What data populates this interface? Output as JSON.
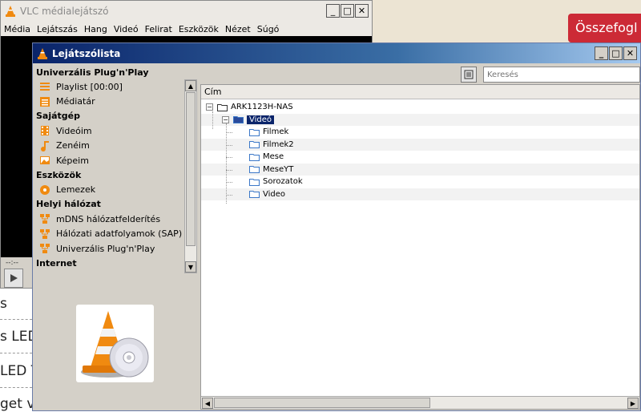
{
  "background_page": {
    "button_label": "Összefogl",
    "text_lines": [
      "s",
      "s LED",
      "LED T",
      "get v"
    ]
  },
  "vlc_main": {
    "title": "VLC médialejátszó",
    "menu": [
      "Média",
      "Lejátszás",
      "Hang",
      "Videó",
      "Felirat",
      "Eszközök",
      "Nézet",
      "Súgó"
    ],
    "time": "--:--"
  },
  "playlist": {
    "title": "Lejátszólista",
    "current_source": "Univerzális Plug'n'Play",
    "sources": [
      {
        "type": "item",
        "label": "Playlist [00:00]",
        "icon": "playlist-icon"
      },
      {
        "type": "item",
        "label": "Médiatár",
        "icon": "media-library-icon"
      },
      {
        "type": "category",
        "label": "Sajátgép"
      },
      {
        "type": "item",
        "label": "Videóim",
        "icon": "film-icon"
      },
      {
        "type": "item",
        "label": "Zenéim",
        "icon": "music-note-icon"
      },
      {
        "type": "item",
        "label": "Képeim",
        "icon": "picture-icon"
      },
      {
        "type": "category",
        "label": "Eszközök"
      },
      {
        "type": "item",
        "label": "Lemezek",
        "icon": "disc-icon"
      },
      {
        "type": "category",
        "label": "Helyi hálózat"
      },
      {
        "type": "item",
        "label": "mDNS hálózatfelderítés",
        "icon": "network-icon"
      },
      {
        "type": "item",
        "label": "Hálózati adatfolyamok (SAP)",
        "icon": "network-icon"
      },
      {
        "type": "item",
        "label": "Univerzális Plug'n'Play",
        "icon": "network-icon"
      },
      {
        "type": "category",
        "label": "Internet"
      }
    ],
    "search": {
      "placeholder": "Keresés",
      "value": ""
    },
    "column_header": "Cím",
    "tree": [
      {
        "label": "ARK1123H-NAS",
        "level": 0,
        "expandable": true,
        "selected": false
      },
      {
        "label": "Videó",
        "level": 1,
        "expandable": true,
        "selected": true
      },
      {
        "label": "Filmek",
        "level": 2,
        "expandable": false,
        "selected": false
      },
      {
        "label": "Filmek2",
        "level": 2,
        "expandable": false,
        "selected": false
      },
      {
        "label": "Mese",
        "level": 2,
        "expandable": false,
        "selected": false
      },
      {
        "label": "MeseYT",
        "level": 2,
        "expandable": false,
        "selected": false
      },
      {
        "label": "Sorozatok",
        "level": 2,
        "expandable": false,
        "selected": false
      },
      {
        "label": "Video",
        "level": 2,
        "expandable": false,
        "selected": false
      }
    ]
  },
  "colors": {
    "selection": "#0a246a",
    "window_bg": "#d4d0c8",
    "folder": "#3c78c8",
    "vlc_orange": "#f08a10",
    "bg_button": "#cc2a36"
  }
}
